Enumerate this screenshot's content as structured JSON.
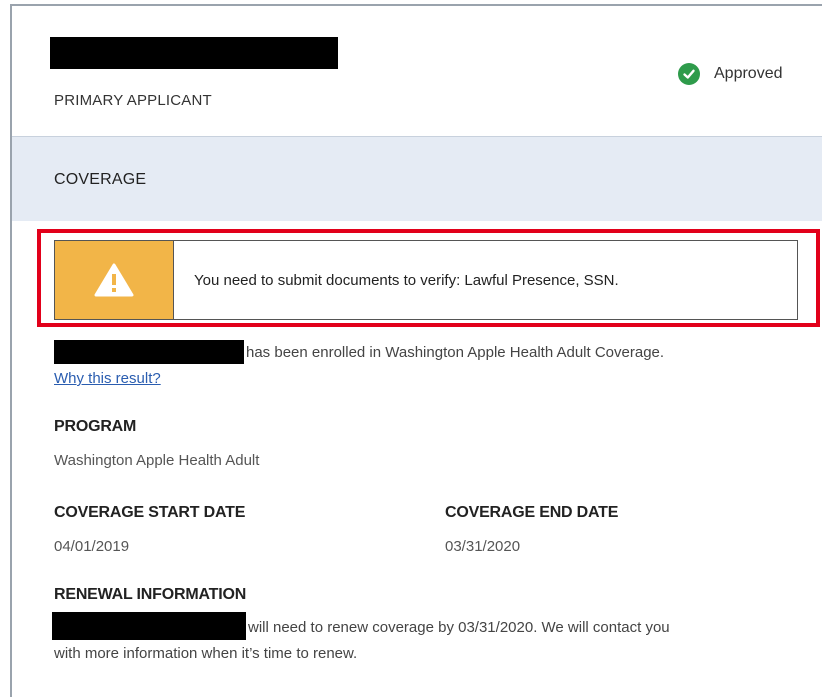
{
  "applicant": {
    "role_label": "PRIMARY APPLICANT",
    "status": "Approved"
  },
  "coverage": {
    "section_title": "COVERAGE",
    "alert_message": "You need to submit documents to verify: Lawful Presence, SSN.",
    "enrollment_text": "has been enrolled in Washington Apple Health Adult Coverage.",
    "why_link": "Why this result?"
  },
  "program": {
    "label": "PROGRAM",
    "value": "Washington Apple Health Adult"
  },
  "dates": {
    "start_label": "COVERAGE START DATE",
    "start_value": "04/01/2019",
    "end_label": "COVERAGE END DATE",
    "end_value": "03/31/2020"
  },
  "renewal": {
    "label": "RENEWAL INFORMATION",
    "text_line1": "will need to renew coverage by 03/31/2020. We will contact you",
    "text_line2": "with more information when it’s time to renew."
  },
  "colors": {
    "status_green": "#2e9b4b",
    "warning_orange": "#f2b548",
    "highlight_red": "#e2001a",
    "band_blue": "#e5ebf4",
    "link_blue": "#2a5db0"
  }
}
